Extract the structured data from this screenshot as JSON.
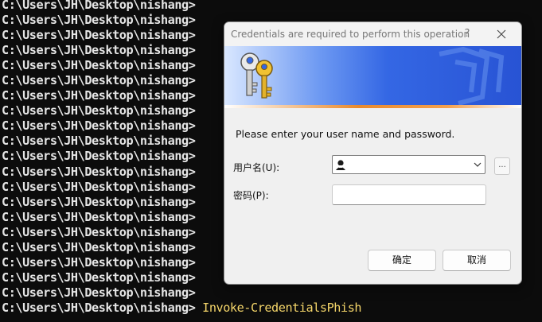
{
  "terminal": {
    "prompt_lines": [
      "C:\\Users\\JH\\Desktop\\nishang>",
      "C:\\Users\\JH\\Desktop\\nishang>",
      "C:\\Users\\JH\\Desktop\\nishang>",
      "C:\\Users\\JH\\Desktop\\nishang>",
      "C:\\Users\\JH\\Desktop\\nishang>",
      "C:\\Users\\JH\\Desktop\\nishang>",
      "C:\\Users\\JH\\Desktop\\nishang>",
      "C:\\Users\\JH\\Desktop\\nishang>",
      "C:\\Users\\JH\\Desktop\\nishang>",
      "C:\\Users\\JH\\Desktop\\nishang>",
      "C:\\Users\\JH\\Desktop\\nishang>",
      "C:\\Users\\JH\\Desktop\\nishang>",
      "C:\\Users\\JH\\Desktop\\nishang>",
      "C:\\Users\\JH\\Desktop\\nishang>",
      "C:\\Users\\JH\\Desktop\\nishang>",
      "C:\\Users\\JH\\Desktop\\nishang>",
      "C:\\Users\\JH\\Desktop\\nishang>",
      "C:\\Users\\JH\\Desktop\\nishang>",
      "C:\\Users\\JH\\Desktop\\nishang>",
      "C:\\Users\\JH\\Desktop\\nishang>"
    ],
    "last_prompt": "C:\\Users\\JH\\Desktop\\nishang> ",
    "command": "Invoke-CredentialsPhish",
    "command_color": "#f5d66a"
  },
  "dialog": {
    "title": "Credentials are required to perform this operation",
    "help_label": "?",
    "close_icon": "close-icon",
    "banner_icon": "keys-icon",
    "prompt_text": "Please enter your user name and password.",
    "username_label": "用户名(U):",
    "username_value": "",
    "user_icon": "user-icon",
    "browse_label": "...",
    "password_label": "密码(P):",
    "password_value": "",
    "ok_label": "确定",
    "cancel_label": "取消",
    "banner_color": "#3467e4",
    "accent_line_color": "#e88a2e"
  }
}
